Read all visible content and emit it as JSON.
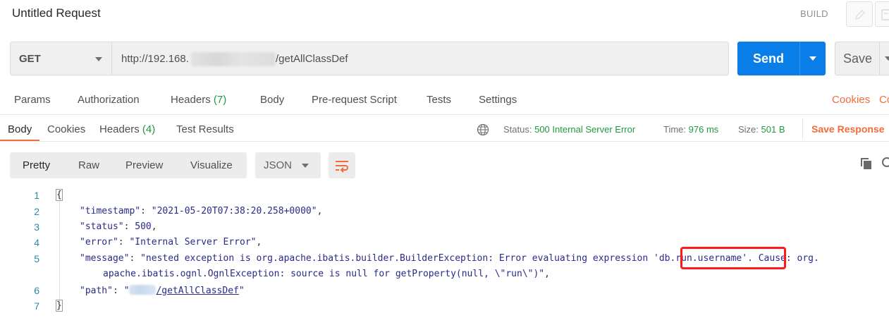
{
  "header": {
    "title": "Untitled Request",
    "build_label": "BUILD"
  },
  "request": {
    "method": "GET",
    "url_prefix": "http://192.168.",
    "url_suffix": "/getAllClassDef",
    "send_label": "Send",
    "save_label": "Save"
  },
  "request_tabs": {
    "params": "Params",
    "authorization": "Authorization",
    "headers": "Headers",
    "headers_count": "(7)",
    "body": "Body",
    "pre_request": "Pre-request Script",
    "tests": "Tests",
    "settings": "Settings",
    "cookies": "Cookies",
    "code": "Co"
  },
  "response_tabs": {
    "body": "Body",
    "cookies": "Cookies",
    "headers": "Headers",
    "headers_count": "(4)",
    "test_results": "Test Results"
  },
  "response_meta": {
    "status_label": "Status:",
    "status_value": "500 Internal Server Error",
    "time_label": "Time:",
    "time_value": "976 ms",
    "size_label": "Size:",
    "size_value": "501 B",
    "save_response": "Save Response"
  },
  "view_modes": {
    "pretty": "Pretty",
    "raw": "Raw",
    "preview": "Preview",
    "visualize": "Visualize",
    "format": "JSON"
  },
  "code": {
    "line_numbers": [
      "1",
      "2",
      "3",
      "4",
      "5",
      "6",
      "7"
    ],
    "open_brace": "{",
    "close_brace": "}",
    "timestamp_key": "\"timestamp\"",
    "timestamp_val": "\"2021-05-20T07:38:20.258+0000\"",
    "status_key": "\"status\"",
    "status_val": "500",
    "error_key": "\"error\"",
    "error_val": "\"Internal Server Error\"",
    "message_key": "\"message\"",
    "message_val_1a": "\"nested exception is org.apache.ibatis.builder.BuilderException: Error evaluating expression ",
    "message_val_1b": "'db.run.username'",
    "message_val_1c": ". Cause: org.",
    "message_val_2": "apache.ibatis.ognl.OgnlException: source is null for getProperty(null, \\\"run\\\")\"",
    "path_key": "\"path\"",
    "path_val_open": "\"",
    "path_val_link": "/getAllClassDef",
    "path_val_close": "\""
  },
  "colors": {
    "accent": "#f26b3a",
    "primary": "#0a7ee8",
    "success": "#1f9a3f",
    "highlight": "#ff1a1a"
  },
  "icons": [
    "edit-icon",
    "document-icon",
    "globe-icon",
    "wrap-icon",
    "copy-icon",
    "search-icon"
  ]
}
